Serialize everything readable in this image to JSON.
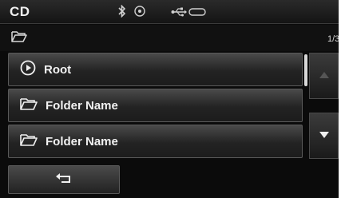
{
  "status_bar": {
    "source_title": "CD",
    "icons": [
      "bluetooth-icon",
      "disc-icon",
      "usb-icon",
      "ipod-icon"
    ]
  },
  "path_bar": {
    "icon": "folder-open-icon",
    "page_indicator": "1/3"
  },
  "list": {
    "items": [
      {
        "icon": "play-circle-icon",
        "label": "Root"
      },
      {
        "icon": "folder-open-icon",
        "label": "Folder Name"
      },
      {
        "icon": "folder-open-icon",
        "label": "Folder Name"
      }
    ]
  },
  "scroll": {
    "up_icon": "arrow-up-icon",
    "down_icon": "arrow-down-icon",
    "up_enabled": false,
    "down_enabled": true
  },
  "footer": {
    "back_icon": "return-arrow-icon"
  },
  "colors": {
    "background": "#0b0b0b",
    "text": "#f2f2f2",
    "disabled": "#555555"
  }
}
